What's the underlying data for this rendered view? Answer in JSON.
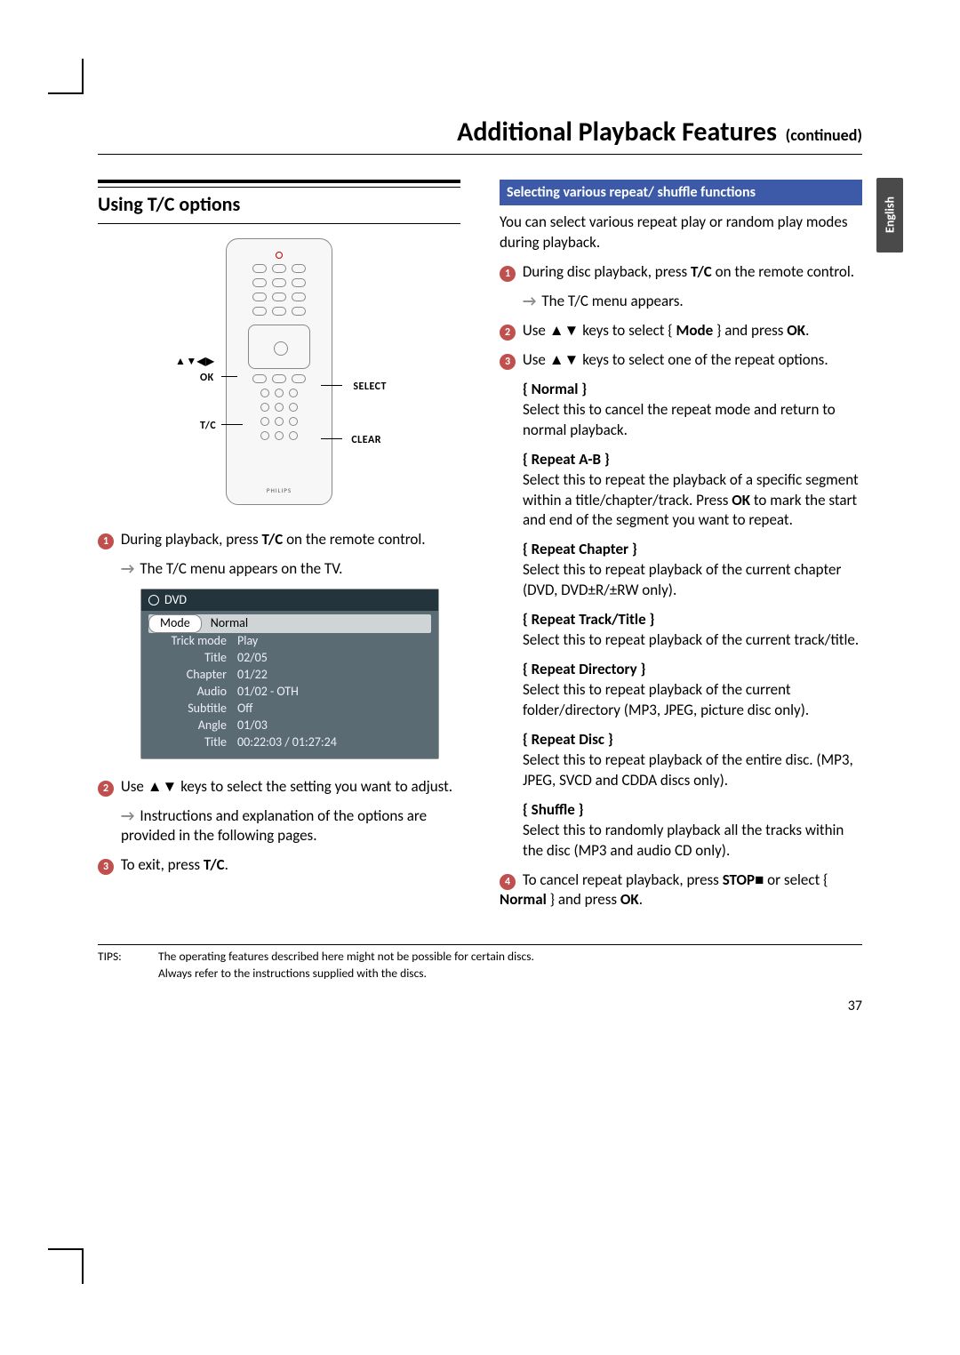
{
  "page": {
    "title_main": "Additional Playback Features",
    "title_cont": "(continued)",
    "lang_tab": "English",
    "page_number": "37"
  },
  "left": {
    "section_heading": "Using T/C options",
    "remote_labels": {
      "arrows": "▲▼◀▶",
      "ok": "OK",
      "tc": "T/C",
      "select": "SELECT",
      "clear": "CLEAR",
      "brand": "PHILIPS"
    },
    "step1_pre": "During playback, press ",
    "step1_bold": "T/C",
    "step1_post": " on the remote control.",
    "step1_sub": "The T/C menu appears on the TV.",
    "osd": {
      "title": "DVD",
      "rows": [
        {
          "k": "Mode",
          "v": "Normal"
        },
        {
          "k": "Trick mode",
          "v": "Play"
        },
        {
          "k": "Title",
          "v": "02/05"
        },
        {
          "k": "Chapter",
          "v": "01/22"
        },
        {
          "k": "Audio",
          "v": "01/02 - OTH"
        },
        {
          "k": "Subtitle",
          "v": "Off"
        },
        {
          "k": "Angle",
          "v": "01/03"
        },
        {
          "k": "Title",
          "v": "00:22:03 / 01:27:24"
        }
      ]
    },
    "step2_pre": "Use ",
    "step2_keys": "▲▼",
    "step2_post": " keys to select the setting you want to adjust.",
    "step2_sub": "Instructions and explanation of the options are provided in the following pages.",
    "step3_pre": "To exit, press ",
    "step3_bold": "T/C",
    "step3_post": "."
  },
  "right": {
    "band": "Selecting various repeat/ shuffle functions",
    "intro": "You can select various repeat play or random play modes during playback.",
    "s1_pre": "During disc playback, press ",
    "s1_bold": "T/C",
    "s1_post": " on the remote control.",
    "s1_sub": "The T/C menu appears.",
    "s2_pre": "Use ",
    "s2_keys": "▲▼",
    "s2_mid": " keys to select { ",
    "s2_bold": "Mode",
    "s2_post": " } and press ",
    "s2_ok": "OK",
    "s2_end": ".",
    "s3_pre": "Use ",
    "s3_keys": "▲▼",
    "s3_post": " keys to select one of the repeat options.",
    "opts": {
      "normal_h": "{ Normal }",
      "normal_b": "Select this to cancel the repeat mode and return to normal playback.",
      "ab_h": "{ Repeat A-B }",
      "ab_b_pre": "Select this to repeat the playback of a specific segment within a title/chapter/track. Press ",
      "ab_b_bold": "OK",
      "ab_b_post": " to mark the start and end of the segment you want to repeat.",
      "ch_h": "{ Repeat Chapter }",
      "ch_b": "Select this to repeat playback of the current chapter (DVD, DVD±R/±RW only).",
      "tt_h": "{ Repeat Track/Title }",
      "tt_b": "Select this to repeat playback of the current track/title.",
      "dir_h": "{ Repeat Directory }",
      "dir_b": "Select this to repeat playback of the current folder/directory (MP3, JPEG, picture disc only).",
      "disc_h": "{ Repeat Disc }",
      "disc_b": "Select this to repeat playback of the entire disc. (MP3, JPEG, SVCD and CDDA discs only).",
      "shuf_h": "{ Shuffle }",
      "shuf_b": "Select this to randomly playback all the tracks within the disc (MP3 and audio CD only)."
    },
    "s4_pre": "To cancel repeat playback, press ",
    "s4_bold": "STOP",
    "s4_sq": "■",
    "s4_mid": " or select { ",
    "s4_bold2": "Normal",
    "s4_mid2": " } and press ",
    "s4_ok": "OK",
    "s4_end": "."
  },
  "tips": {
    "label": "TIPS:",
    "line1": "The operating features described here might not be possible for certain discs.",
    "line2": "Always refer to the instructions supplied with the discs."
  }
}
